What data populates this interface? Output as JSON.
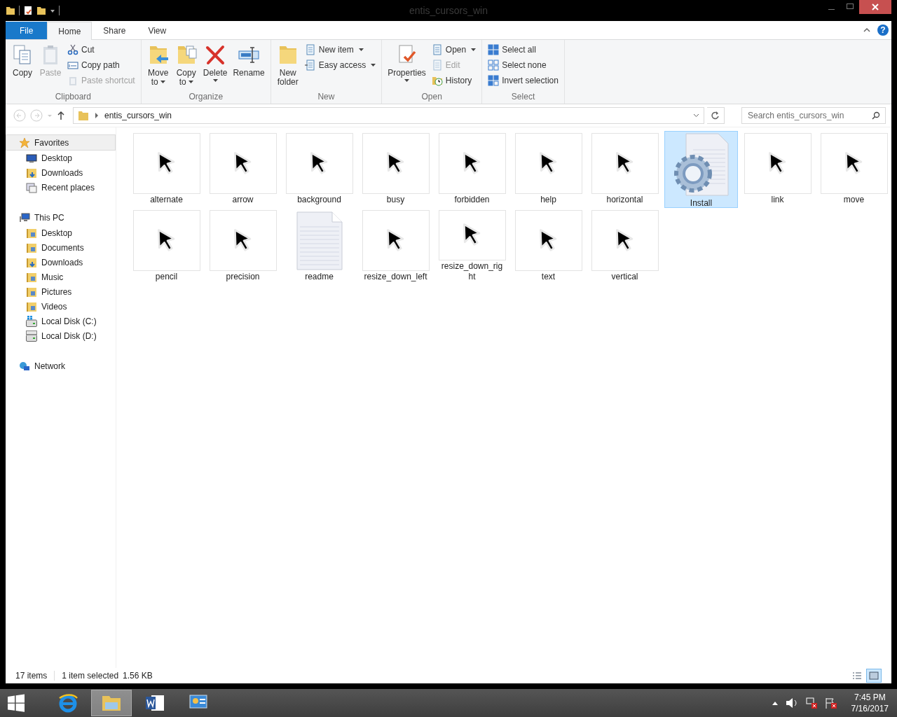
{
  "window": {
    "title": "entis_cursors_win"
  },
  "ribbon": {
    "tabs": [
      {
        "label": "File",
        "kind": "file",
        "selected": false
      },
      {
        "label": "Home",
        "kind": "tab",
        "selected": true
      },
      {
        "label": "Share",
        "kind": "tab",
        "selected": false
      },
      {
        "label": "View",
        "kind": "tab",
        "selected": false
      }
    ],
    "help": "?",
    "groups": [
      {
        "label": "Clipboard",
        "items": [
          {
            "lines": [
              "Copy"
            ],
            "kind": "large",
            "disabled": false,
            "dropdown": false
          },
          {
            "lines": [
              "Paste"
            ],
            "kind": "large",
            "disabled": true,
            "dropdown": false
          },
          {
            "lines": [
              "Cut"
            ],
            "kind": "small",
            "disabled": false,
            "dropdown": false
          },
          {
            "lines": [
              "Copy path"
            ],
            "kind": "small",
            "disabled": false,
            "dropdown": false
          },
          {
            "lines": [
              "Paste shortcut"
            ],
            "kind": "small",
            "disabled": true,
            "dropdown": false
          }
        ]
      },
      {
        "label": "Organize",
        "items": [
          {
            "lines": [
              "Move",
              "to"
            ],
            "kind": "large",
            "disabled": false,
            "dropdown": true
          },
          {
            "lines": [
              "Copy",
              "to"
            ],
            "kind": "large",
            "disabled": false,
            "dropdown": true
          },
          {
            "lines": [
              "Delete"
            ],
            "kind": "large",
            "disabled": false,
            "dropdown": true
          },
          {
            "lines": [
              "Rename"
            ],
            "kind": "large",
            "disabled": false,
            "dropdown": false
          }
        ]
      },
      {
        "label": "New",
        "items": [
          {
            "lines": [
              "New",
              "folder"
            ],
            "kind": "large",
            "disabled": false,
            "dropdown": false
          },
          {
            "lines": [
              "New item"
            ],
            "kind": "small",
            "disabled": false,
            "dropdown": true
          },
          {
            "lines": [
              "Easy access"
            ],
            "kind": "small",
            "disabled": false,
            "dropdown": true
          }
        ]
      },
      {
        "label": "Open",
        "items": [
          {
            "lines": [
              "Properties"
            ],
            "kind": "large",
            "disabled": false,
            "dropdown": true
          },
          {
            "lines": [
              "Open"
            ],
            "kind": "small",
            "disabled": false,
            "dropdown": true
          },
          {
            "lines": [
              "Edit"
            ],
            "kind": "small",
            "disabled": true,
            "dropdown": false
          },
          {
            "lines": [
              "History"
            ],
            "kind": "small",
            "disabled": false,
            "dropdown": false
          }
        ]
      },
      {
        "label": "Select",
        "items": [
          {
            "lines": [
              "Select all"
            ],
            "kind": "small",
            "disabled": false,
            "dropdown": false
          },
          {
            "lines": [
              "Select none"
            ],
            "kind": "small",
            "disabled": false,
            "dropdown": false
          },
          {
            "lines": [
              "Invert selection"
            ],
            "kind": "small",
            "disabled": false,
            "dropdown": false
          }
        ]
      }
    ]
  },
  "address_bar": {
    "path": "entis_cursors_win"
  },
  "search": {
    "placeholder": "Search entis_cursors_win"
  },
  "sidebar": {
    "sections": [
      {
        "label": "Favorites",
        "selected": true,
        "children": [
          {
            "label": "Desktop"
          },
          {
            "label": "Downloads"
          },
          {
            "label": "Recent places"
          }
        ]
      },
      {
        "label": "This PC",
        "selected": false,
        "children": [
          {
            "label": "Desktop"
          },
          {
            "label": "Documents"
          },
          {
            "label": "Downloads"
          },
          {
            "label": "Music"
          },
          {
            "label": "Pictures"
          },
          {
            "label": "Videos"
          },
          {
            "label": "Local Disk (C:)"
          },
          {
            "label": "Local Disk (D:)"
          }
        ]
      },
      {
        "label": "Network",
        "selected": false
      }
    ]
  },
  "files": [
    {
      "name": "alternate",
      "kind": "cursor",
      "selected": false
    },
    {
      "name": "arrow",
      "kind": "cursor",
      "selected": false
    },
    {
      "name": "background",
      "kind": "cursor",
      "selected": false
    },
    {
      "name": "busy",
      "kind": "cursor",
      "selected": false
    },
    {
      "name": "forbidden",
      "kind": "cursor",
      "selected": false
    },
    {
      "name": "help",
      "kind": "cursor",
      "selected": false
    },
    {
      "name": "horizontal",
      "kind": "cursor",
      "selected": false
    },
    {
      "name": "Install",
      "kind": "setup",
      "selected": true
    },
    {
      "name": "link",
      "kind": "cursor",
      "selected": false
    },
    {
      "name": "move",
      "kind": "cursor",
      "selected": false
    },
    {
      "name": "pencil",
      "kind": "cursor",
      "selected": false
    },
    {
      "name": "precision",
      "kind": "cursor",
      "selected": false
    },
    {
      "name": "readme",
      "kind": "text",
      "selected": false
    },
    {
      "name": "resize_down_left",
      "kind": "cursor",
      "selected": false
    },
    {
      "name": "resize_down_right",
      "kind": "cursor",
      "selected": false
    },
    {
      "name": "text",
      "kind": "cursor",
      "selected": false
    },
    {
      "name": "vertical",
      "kind": "cursor",
      "selected": false
    }
  ],
  "status_bar": {
    "item_count": "17 items",
    "selection": "1 item selected",
    "size": "1.56 KB",
    "view_buttons": [
      {
        "selected": false
      },
      {
        "selected": true
      }
    ]
  },
  "taskbar": {
    "apps": [
      {
        "selected": false
      },
      {
        "selected": true
      },
      {
        "selected": false
      },
      {
        "selected": false
      }
    ],
    "time": "7:45 PM",
    "date": "7/16/2017"
  }
}
